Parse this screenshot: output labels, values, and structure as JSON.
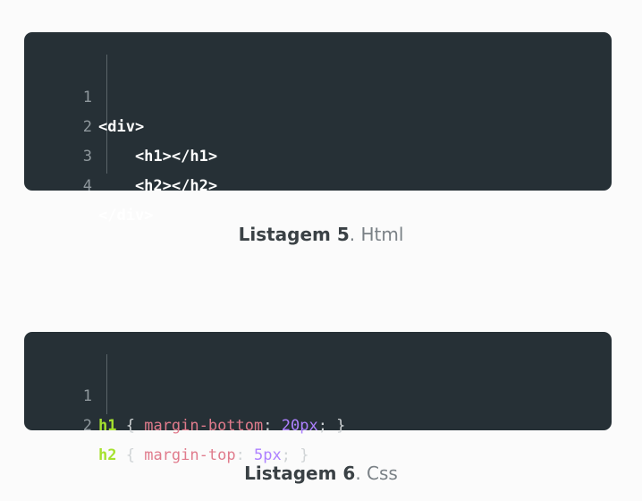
{
  "listing5": {
    "lines": [
      {
        "num": "1",
        "code": "<div>"
      },
      {
        "num": "2",
        "code": "    <h1></h1>"
      },
      {
        "num": "3",
        "code": "    <h2></h2>"
      },
      {
        "num": "4",
        "code": "</div>"
      }
    ],
    "caption_label": "Listagem 5",
    "caption_sep": ".",
    "caption_desc": " Html"
  },
  "listing6": {
    "lines": [
      {
        "num": "1",
        "selector": "h1",
        "open": " { ",
        "prop": "margin-bottom",
        "colon": ": ",
        "value": "20px",
        "close": "; }"
      },
      {
        "num": "2",
        "selector": "h2",
        "open": " { ",
        "prop": "margin-top",
        "colon": ": ",
        "value": "5px",
        "close": "; }"
      }
    ],
    "caption_label": "Listagem 6",
    "caption_sep": ".",
    "caption_desc": " Css"
  },
  "colors": {
    "code_background": "#263036",
    "selector": "#a6e22e",
    "property": "#e07b8c",
    "number": "#ae81ff"
  }
}
